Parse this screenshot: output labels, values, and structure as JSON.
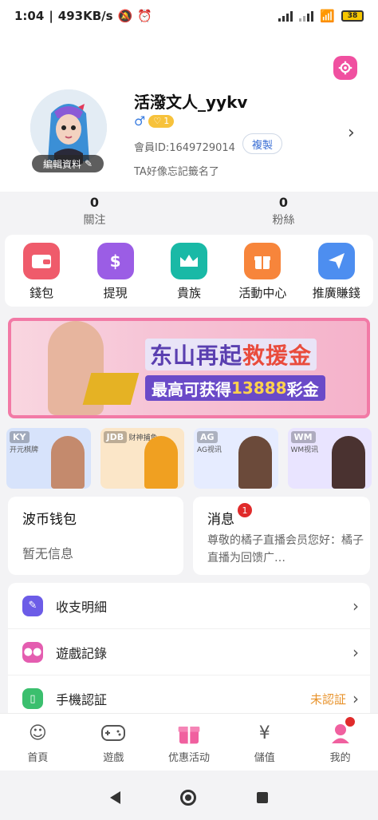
{
  "status_bar": {
    "time": "1:04",
    "speed": "493KB/s",
    "battery": "38"
  },
  "profile": {
    "username": "活潑文人_yykv",
    "gender_symbol": "♂",
    "level": "1",
    "id_label": "會員ID:1649729014",
    "copy_label": "複製",
    "signature": "TA好像忘記籤名了",
    "edit_label": "編輯資料"
  },
  "stats": {
    "following_count": "0",
    "following_label": "關注",
    "fans_count": "0",
    "fans_label": "粉絲"
  },
  "quick_actions": [
    {
      "label": "錢包",
      "icon": "wallet-icon",
      "color": "#ef5b6b"
    },
    {
      "label": "提現",
      "icon": "money-bag-icon",
      "color": "#9b5de5"
    },
    {
      "label": "貴族",
      "icon": "crown-icon",
      "color": "#19b9a6"
    },
    {
      "label": "活動中心",
      "icon": "gift-icon",
      "color": "#f7853b"
    },
    {
      "label": "推廣賺錢",
      "icon": "paper-plane-icon",
      "color": "#4d8ef0"
    }
  ],
  "banner": {
    "title_a": "东山再起",
    "title_b": "救援金",
    "subtitle_a": "最高可获得",
    "subtitle_b": "13888",
    "subtitle_c": "彩金"
  },
  "games": [
    {
      "name": "开元棋牌",
      "logo": "KY",
      "bg": "#d7e3fb",
      "fig": "#c48a6d"
    },
    {
      "name": "财神捕鱼",
      "logo": "JDB",
      "bg": "#fbe6c8",
      "fig": "#f0a021"
    },
    {
      "name": "AG视讯",
      "logo": "AG",
      "bg": "#e6ecff",
      "fig": "#6b4a3a"
    },
    {
      "name": "WM视讯",
      "logo": "WM",
      "bg": "#e9e4ff",
      "fig": "#4a3230"
    }
  ],
  "wallet_card": {
    "title": "波币钱包",
    "value": "暂无信息"
  },
  "message_card": {
    "title": "消息",
    "badge": "1",
    "preview": "尊敬的橘子直播会员您好：橘子直播为回馈广…"
  },
  "menu": [
    {
      "label": "收支明細",
      "icon": "receipt-icon",
      "color": "#6c5ce7",
      "status": ""
    },
    {
      "label": "遊戲記錄",
      "icon": "gamepad-icon",
      "color": "#e45db0",
      "status": ""
    },
    {
      "label": "手機認証",
      "icon": "phone-icon",
      "color": "#3bbf6e",
      "status": "未認証"
    }
  ],
  "tabs": [
    {
      "label": "首頁",
      "icon": "home-avatar-icon"
    },
    {
      "label": "遊戲",
      "icon": "gamepad-icon"
    },
    {
      "label": "优惠活动",
      "icon": "gift-icon"
    },
    {
      "label": "儲值",
      "icon": "yen-plus-icon"
    },
    {
      "label": "我的",
      "icon": "profile-icon"
    }
  ],
  "colors": {
    "accent_pink": "#f050a0",
    "link_blue": "#3b6fd4",
    "warning_orange": "#e8932c",
    "badge_red": "#e02b2b"
  }
}
